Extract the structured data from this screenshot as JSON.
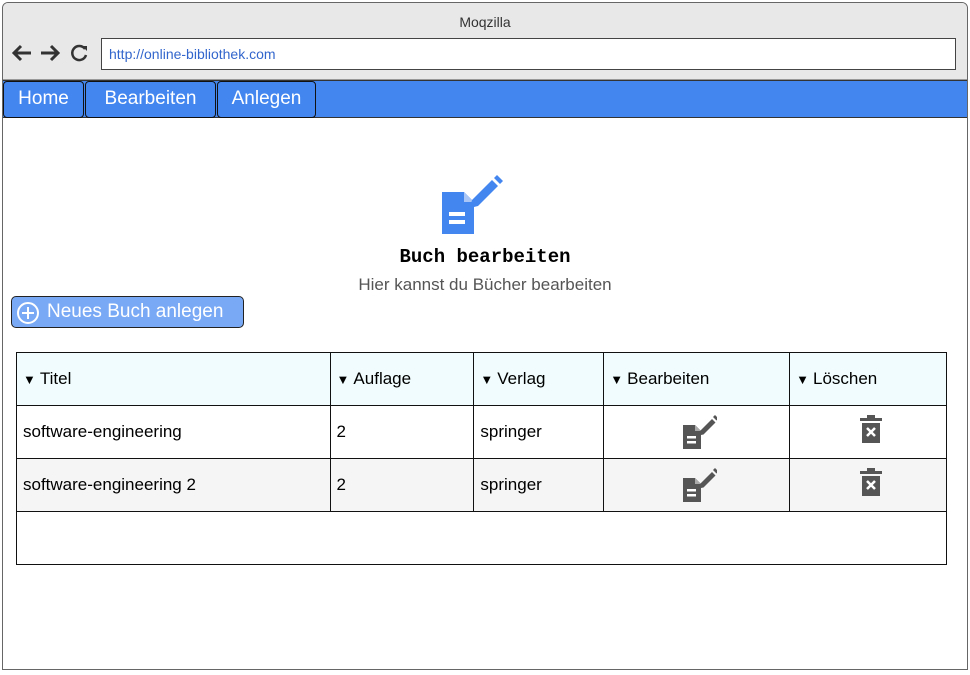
{
  "window": {
    "title": "Moqzilla"
  },
  "browser": {
    "url": "http://online-bibliothek.com"
  },
  "menu": {
    "items": [
      {
        "label": "Home"
      },
      {
        "label": "Bearbeiten"
      },
      {
        "label": "Anlegen"
      }
    ]
  },
  "header": {
    "icon": "edit-document-icon",
    "title": "Buch bearbeiten",
    "subtitle": "Hier kannst du Bücher bearbeiten"
  },
  "new_book_button": {
    "label": "Neues Buch anlegen",
    "icon": "plus-circle-icon"
  },
  "table": {
    "sort_indicator": "▼",
    "columns": [
      "Titel",
      "Auflage",
      "Verlag",
      "Bearbeiten",
      "Löschen"
    ],
    "rows": [
      {
        "titel": "software-engineering",
        "auflage": "2",
        "verlag": "springer",
        "edit_icon": "edit-document-icon",
        "delete_icon": "trash-icon"
      },
      {
        "titel": "software-engineering 2",
        "auflage": "2",
        "verlag": "springer",
        "edit_icon": "edit-document-icon",
        "delete_icon": "trash-icon"
      }
    ]
  },
  "colors": {
    "accent": "#4386f0",
    "button": "#79a9f5",
    "header_row": "#f0fcfd",
    "alt_row": "#f5f5f5",
    "icon_dark": "#555555"
  }
}
